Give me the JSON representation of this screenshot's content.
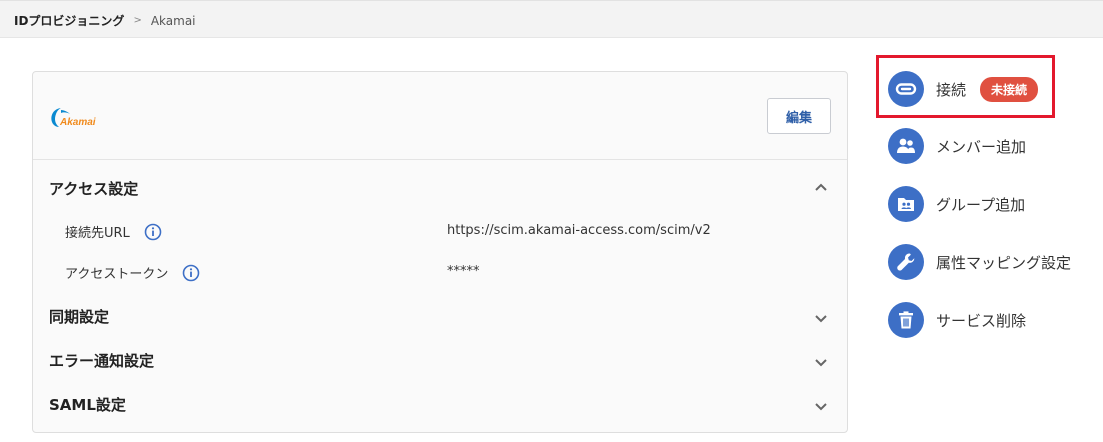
{
  "breadcrumb": {
    "parent": "IDプロビジョニング",
    "separator": ">",
    "current": "Akamai"
  },
  "card": {
    "logo_text": "Akamai",
    "edit_label": "編集",
    "sections": [
      {
        "title": "アクセス設定",
        "expanded": true,
        "rows": [
          {
            "label": "接続先URL",
            "value": "https://scim.akamai-access.com/scim/v2"
          },
          {
            "label": "アクセストークン",
            "value": "*****"
          }
        ]
      },
      {
        "title": "同期設定",
        "expanded": false
      },
      {
        "title": "エラー通知設定",
        "expanded": false
      },
      {
        "title": "SAML設定",
        "expanded": false
      }
    ]
  },
  "actions": [
    {
      "label": "接続",
      "badge": "未接続",
      "icon": "link-icon"
    },
    {
      "label": "メンバー追加",
      "icon": "group-icon"
    },
    {
      "label": "グループ追加",
      "icon": "folder-group-icon"
    },
    {
      "label": "属性マッピング設定",
      "icon": "wrench-icon"
    },
    {
      "label": "サービス削除",
      "icon": "trash-icon"
    }
  ],
  "colors": {
    "accent": "#3d6fc6",
    "badge": "#e05040",
    "highlight": "#e3182d",
    "edit_text": "#2f5fa8"
  }
}
